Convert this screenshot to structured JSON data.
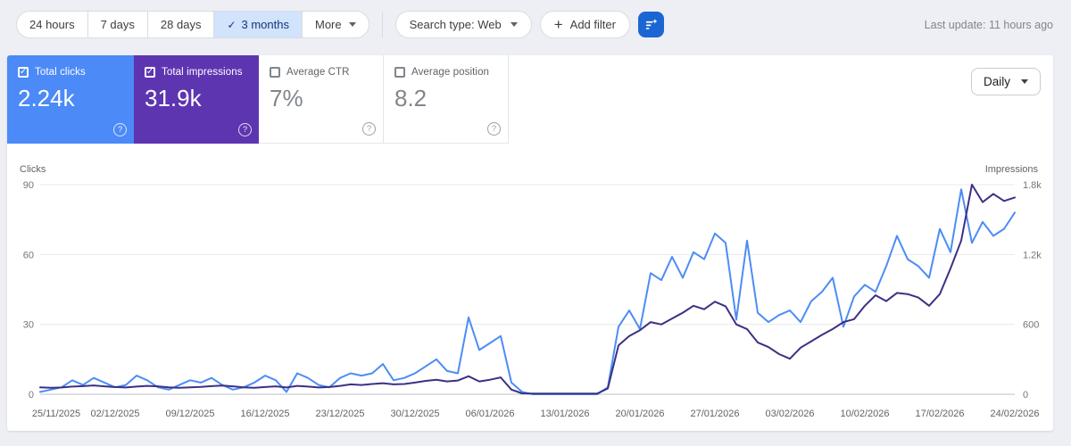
{
  "toolbar": {
    "date_tabs": [
      {
        "label": "24 hours",
        "selected": false
      },
      {
        "label": "7 days",
        "selected": false
      },
      {
        "label": "28 days",
        "selected": false
      },
      {
        "label": "3 months",
        "selected": true
      },
      {
        "label": "More",
        "selected": false
      }
    ],
    "search_type_label": "Search type: Web",
    "add_filter_label": "Add filter",
    "last_update": "Last update: 11 hours ago"
  },
  "icons": {
    "check": "✓",
    "plus": "+",
    "help": "?"
  },
  "cards": [
    {
      "label": "Total clicks",
      "value": "2.24k",
      "checked": true,
      "bg": "#4b8af7"
    },
    {
      "label": "Total impressions",
      "value": "31.9k",
      "checked": true,
      "bg": "#5e35b1"
    },
    {
      "label": "Average CTR",
      "value": "7%",
      "checked": false,
      "bg": "#ffffff"
    },
    {
      "label": "Average position",
      "value": "8.2",
      "checked": false,
      "bg": "#ffffff"
    }
  ],
  "granularity": {
    "selected": "Daily"
  },
  "chart_data": {
    "type": "line",
    "frequency": "daily",
    "start_date": "25/11/2025",
    "end_date": "24/02/2026",
    "x_tick_labels": [
      "25/11/2025",
      "02/12/2025",
      "09/12/2025",
      "16/12/2025",
      "23/12/2025",
      "30/12/2025",
      "06/01/2026",
      "13/01/2026",
      "20/01/2026",
      "27/01/2026",
      "03/02/2026",
      "10/02/2026",
      "17/02/2026",
      "24/02/2026"
    ],
    "left_axis": {
      "label": "Clicks",
      "max": 90,
      "ticks": [
        0,
        30,
        60,
        90
      ],
      "tick_labels": [
        "0",
        "30",
        "60",
        "90"
      ]
    },
    "right_axis": {
      "label": "Impressions",
      "max": 1800,
      "ticks": [
        0,
        600,
        1200,
        1800
      ],
      "tick_labels": [
        "0",
        "600",
        "1.2k",
        "1.8k"
      ]
    },
    "grid": true,
    "legend_position": "none",
    "series": [
      {
        "name": "Total clicks",
        "axis": "left",
        "color": "#4c8df5",
        "values": [
          1,
          2,
          3,
          6,
          4,
          7,
          5,
          3,
          4,
          8,
          6,
          3,
          2,
          4,
          6,
          5,
          7,
          4,
          2,
          3,
          5,
          8,
          6,
          1,
          9,
          7,
          4,
          3,
          7,
          9,
          8,
          9,
          13,
          6,
          7,
          9,
          12,
          15,
          10,
          9,
          33,
          19,
          22,
          25,
          5,
          1,
          0,
          0,
          0,
          0,
          0,
          0,
          0,
          3,
          29,
          36,
          28,
          52,
          49,
          59,
          50,
          61,
          58,
          69,
          65,
          32,
          66,
          35,
          31,
          34,
          36,
          31,
          40,
          44,
          50,
          29,
          42,
          47,
          44,
          55,
          68,
          58,
          55,
          50,
          71,
          61,
          88,
          65,
          74,
          68,
          71,
          78
        ]
      },
      {
        "name": "Total impressions",
        "axis": "right",
        "color": "#3b3184",
        "values": [
          60,
          55,
          58,
          66,
          70,
          76,
          68,
          62,
          58,
          66,
          72,
          68,
          60,
          56,
          60,
          63,
          70,
          75,
          68,
          60,
          55,
          62,
          68,
          58,
          72,
          66,
          58,
          62,
          72,
          85,
          80,
          88,
          95,
          85,
          88,
          100,
          115,
          125,
          110,
          118,
          155,
          110,
          125,
          145,
          40,
          8,
          5,
          5,
          5,
          5,
          5,
          5,
          5,
          50,
          420,
          500,
          550,
          620,
          600,
          650,
          700,
          760,
          730,
          795,
          755,
          600,
          560,
          445,
          405,
          345,
          305,
          400,
          455,
          510,
          560,
          620,
          645,
          760,
          850,
          800,
          870,
          860,
          830,
          760,
          860,
          1080,
          1320,
          1800,
          1650,
          1720,
          1660,
          1690
        ]
      }
    ]
  }
}
